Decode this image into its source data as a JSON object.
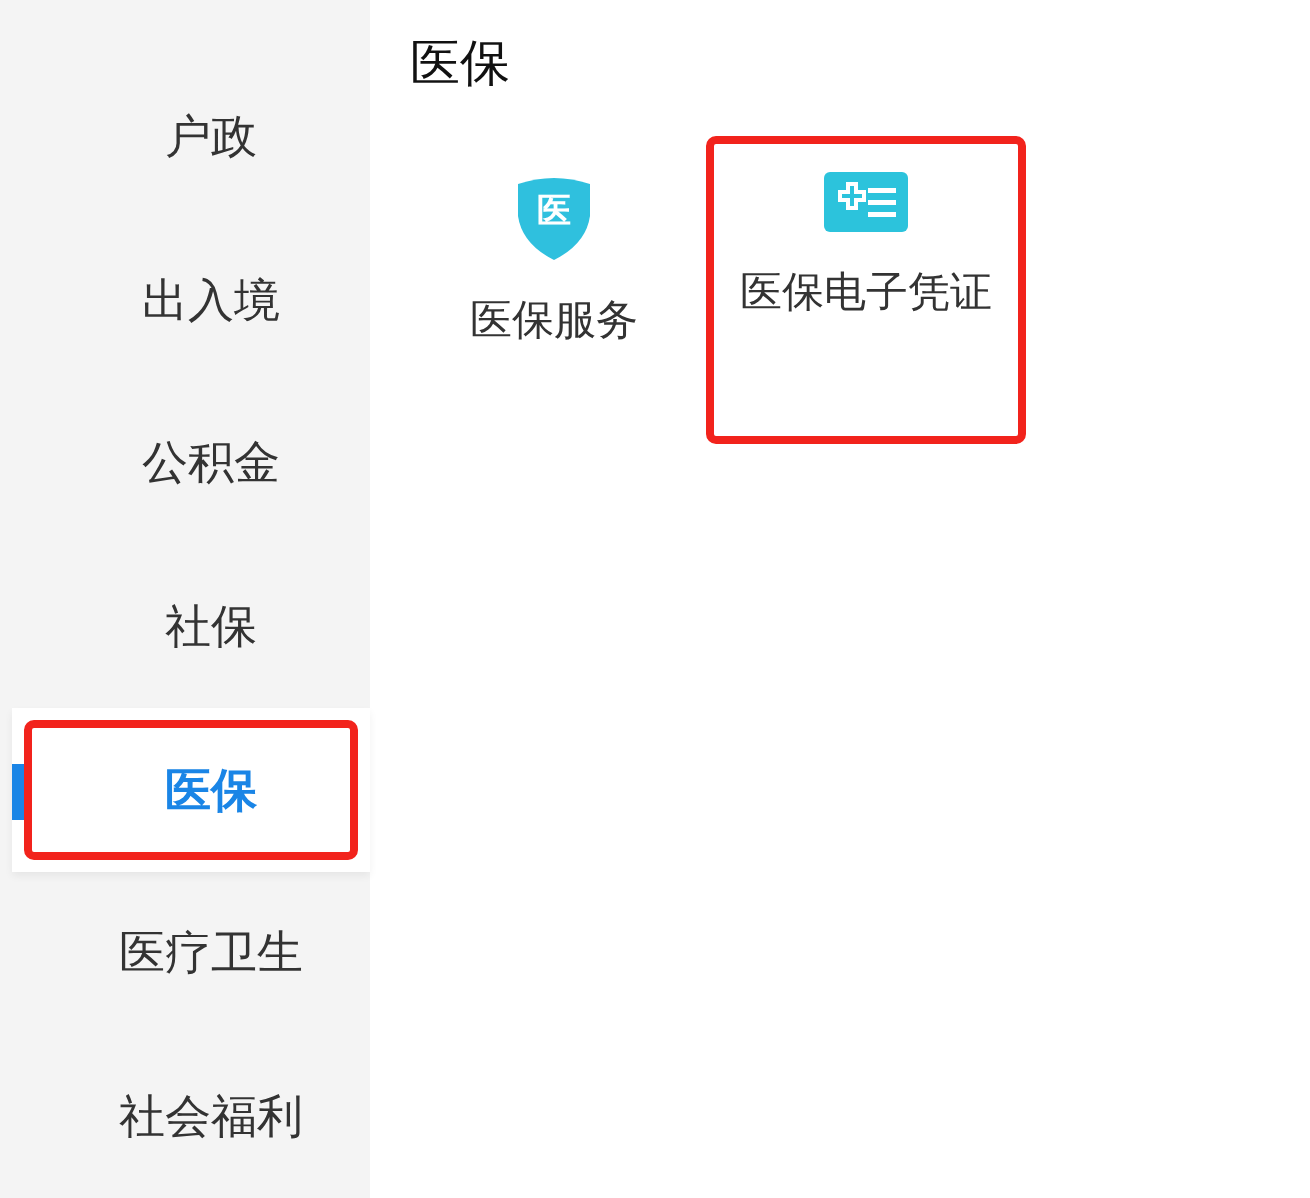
{
  "sidebar": {
    "items": [
      {
        "label": "户政",
        "selected": false,
        "highlighted": false
      },
      {
        "label": "出入境",
        "selected": false,
        "highlighted": false
      },
      {
        "label": "公积金",
        "selected": false,
        "highlighted": false
      },
      {
        "label": "社保",
        "selected": false,
        "highlighted": false
      },
      {
        "label": "医保",
        "selected": true,
        "highlighted": true
      },
      {
        "label": "医疗卫生",
        "selected": false,
        "highlighted": false
      },
      {
        "label": "社会福利",
        "selected": false,
        "highlighted": false
      }
    ]
  },
  "section": {
    "title": "医保",
    "services": [
      {
        "kind": "shield",
        "icon_text": "医",
        "label": "医保服务",
        "highlighted": false
      },
      {
        "kind": "card",
        "label": "医保电子凭证",
        "highlighted": true
      }
    ]
  }
}
